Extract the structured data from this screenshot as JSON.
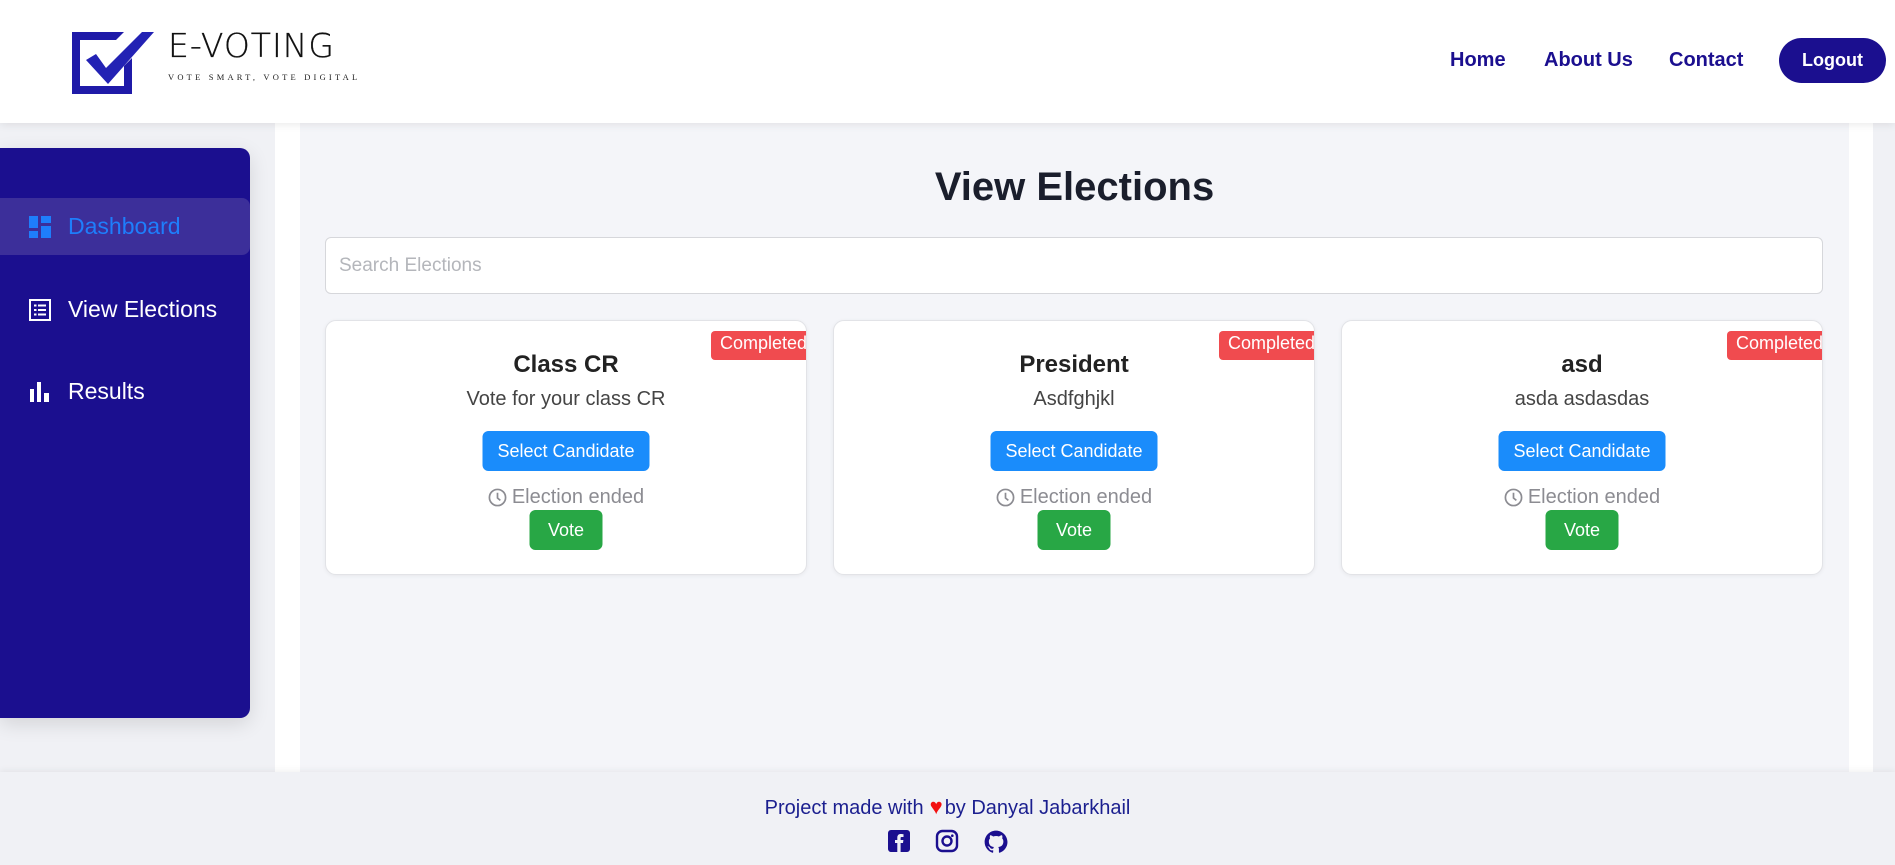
{
  "header": {
    "logo_title": "E-VOTING",
    "logo_tagline": "VOTE SMART, VOTE DIGITAL",
    "nav": [
      {
        "label": "Home"
      },
      {
        "label": "About Us"
      },
      {
        "label": "Contact"
      }
    ],
    "logout_label": "Logout"
  },
  "sidebar": {
    "items": [
      {
        "label": "Dashboard",
        "icon": "dashboard-icon",
        "active": true
      },
      {
        "label": "View Elections",
        "icon": "list-icon",
        "active": false
      },
      {
        "label": "Results",
        "icon": "bar-chart-icon",
        "active": false
      }
    ]
  },
  "main": {
    "title": "View Elections",
    "search": {
      "placeholder": "Search Elections",
      "value": ""
    },
    "elections": [
      {
        "title": "Class CR",
        "description": "Vote for your class CR",
        "status": "Completed",
        "select_label": "Select Candidate",
        "time_status": "Election ended",
        "vote_label": "Vote"
      },
      {
        "title": "President",
        "description": "Asdfghjkl",
        "status": "Completed",
        "select_label": "Select Candidate",
        "time_status": "Election ended",
        "vote_label": "Vote"
      },
      {
        "title": "asd",
        "description": "asda asdasdas",
        "status": "Completed",
        "select_label": "Select Candidate",
        "time_status": "Election ended",
        "vote_label": "Vote"
      }
    ]
  },
  "footer": {
    "text_before": "Project made with",
    "heart": "♥",
    "text_after": "by Danyal Jabarkhail",
    "socials": [
      "facebook-icon",
      "instagram-icon",
      "github-icon"
    ]
  },
  "colors": {
    "brand": "#1b0f8f",
    "active_link": "#1e7efc",
    "select_button": "#1a8cfb",
    "vote_button": "#28a745",
    "completed_badge": "#f04b4f",
    "heart": "#f21010"
  }
}
